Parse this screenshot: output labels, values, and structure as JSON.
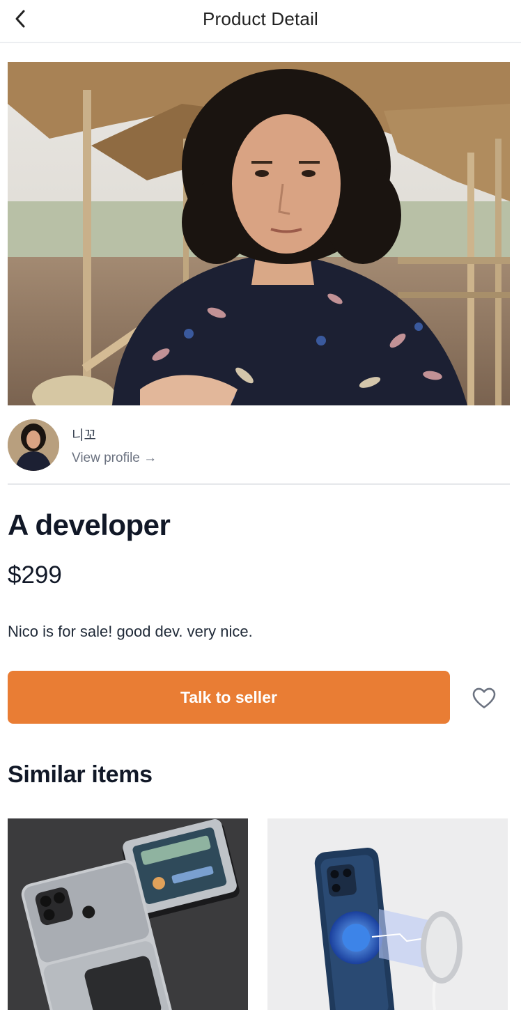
{
  "header": {
    "title": "Product Detail",
    "back_icon": "chevron-left-icon"
  },
  "product": {
    "title": "A developer",
    "price": "$299",
    "description": "Nico is for sale! good dev. very nice."
  },
  "seller": {
    "name": "니꼬",
    "view_profile_label": "View profile →"
  },
  "actions": {
    "talk_label": "Talk to seller",
    "favorite_icon": "heart-outline-icon"
  },
  "similar": {
    "title": "Similar items",
    "items": [
      {
        "image": "foldable-phone-photo"
      },
      {
        "image": "phone-magsafe-charger-photo"
      }
    ]
  },
  "colors": {
    "accent": "#e97d34",
    "text": "#111827",
    "muted": "#6b7280",
    "divider": "#e5e7eb"
  }
}
